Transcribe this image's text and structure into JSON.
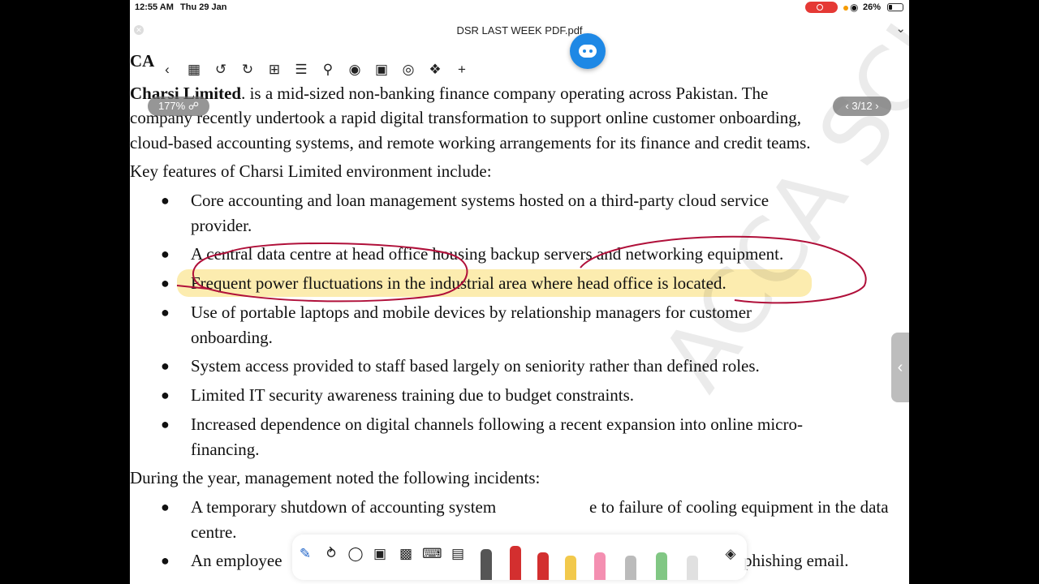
{
  "status_bar": {
    "time": "12:55 AM",
    "date": "Thu 29 Jan",
    "battery": "26%"
  },
  "title_bar": {
    "title": "DSR LAST WEEK PDF.pdf"
  },
  "toolbar": {
    "icons": [
      "back-icon",
      "grid-icon",
      "undo-icon",
      "redo-icon",
      "add-page-icon",
      "layers-icon",
      "search-icon",
      "microphone-icon",
      "clapperboard-icon",
      "globe-icon",
      "lasso-icon",
      "plus-icon"
    ]
  },
  "zoom_label": "177%",
  "page_indicator": "3/12",
  "document": {
    "heading_fragment": "CA",
    "intro_bold": "Charsi Limited",
    "intro_rest": ". is a mid-sized non-banking finance company operating across Pakistan. The",
    "intro_line2": "company recently undertook a rapid digital transformation to support online customer onboarding,",
    "intro_line3": "cloud-based accounting systems, and remote working arrangements for its finance and credit teams.",
    "features_heading": "Key features of Charsi Limited environment include:",
    "features": [
      "Core accounting and loan management systems hosted on a third-party cloud service",
      "provider.",
      "A central data centre at head office housing backup servers and networking equipment.",
      "Frequent power fluctuations in the industrial area where head office is located.",
      "Use of portable laptops and mobile devices by relationship managers for customer",
      "onboarding.",
      "System access provided to staff based largely on seniority rather than defined roles.",
      "Limited IT security awareness training due to budget constraints.",
      "Increased dependence on digital channels following a recent expansion into online micro-",
      "financing."
    ],
    "incidents_heading": "During the year, management noted the following incidents:",
    "incidents": [
      "A temporary shutdown of accounting system",
      "e to failure of cooling equipment in the data",
      "centre.",
      "An employee",
      "phishing email."
    ]
  },
  "watermark": "ACCA SCHOOL",
  "colors": {
    "highlight": "#fadd6e",
    "ink": "#b0103a",
    "assistant": "#1e88e5",
    "record": "#e53935"
  }
}
